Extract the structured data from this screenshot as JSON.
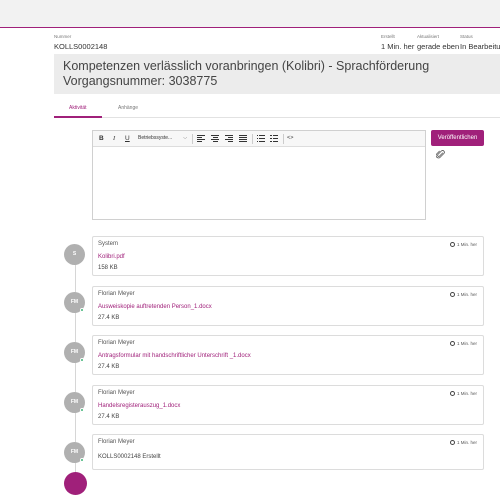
{
  "meta": {
    "nummer_label": "Nummer",
    "nummer_value": "KOLLS0002148",
    "erstellt_label": "Erstellt",
    "erstellt_value": "1 Min. her",
    "aktualisiert_label": "Aktualisiert",
    "aktualisiert_value": "gerade eben",
    "status_label": "Status",
    "status_value": "In Bearbeitung"
  },
  "title": "Kompetenzen verlässlich voranbringen (Kolibri) - Sprachförderung Vorgangsnummer: 3038775",
  "tabs": [
    {
      "label": "Aktivität",
      "active": true
    },
    {
      "label": "Anhänge",
      "active": false
    }
  ],
  "toolbar": {
    "bold": "B",
    "italic": "I",
    "underline": "U",
    "font_select": "Betriebssyste...",
    "code": "<>"
  },
  "publish_label": "Veröffentlichen",
  "activities": [
    {
      "initials": "S",
      "author": "System",
      "time": "1 Min. her",
      "file": "Kolibri.pdf",
      "size": "158 KB",
      "online": false
    },
    {
      "initials": "FM",
      "author": "Florian Meyer",
      "time": "1 Min. her",
      "file": "Ausweiskopie auftretenden Person_1.docx",
      "size": "27.4 KB",
      "online": true
    },
    {
      "initials": "FM",
      "author": "Florian Meyer",
      "time": "1 Min. her",
      "file": "Antragsformular mit handschriftlicher Unterschrift _1.docx",
      "size": "27.4 KB",
      "online": true
    },
    {
      "initials": "FM",
      "author": "Florian Meyer",
      "time": "1 Min. her",
      "file": "Handelsregisterauszug_1.docx",
      "size": "27.4 KB",
      "online": true
    },
    {
      "initials": "FM",
      "author": "Florian Meyer",
      "time": "1 Min. her",
      "text": "KOLLS0002148 Erstellt",
      "online": true
    }
  ],
  "colors": {
    "accent": "#a0207a",
    "online": "#3bb273"
  }
}
